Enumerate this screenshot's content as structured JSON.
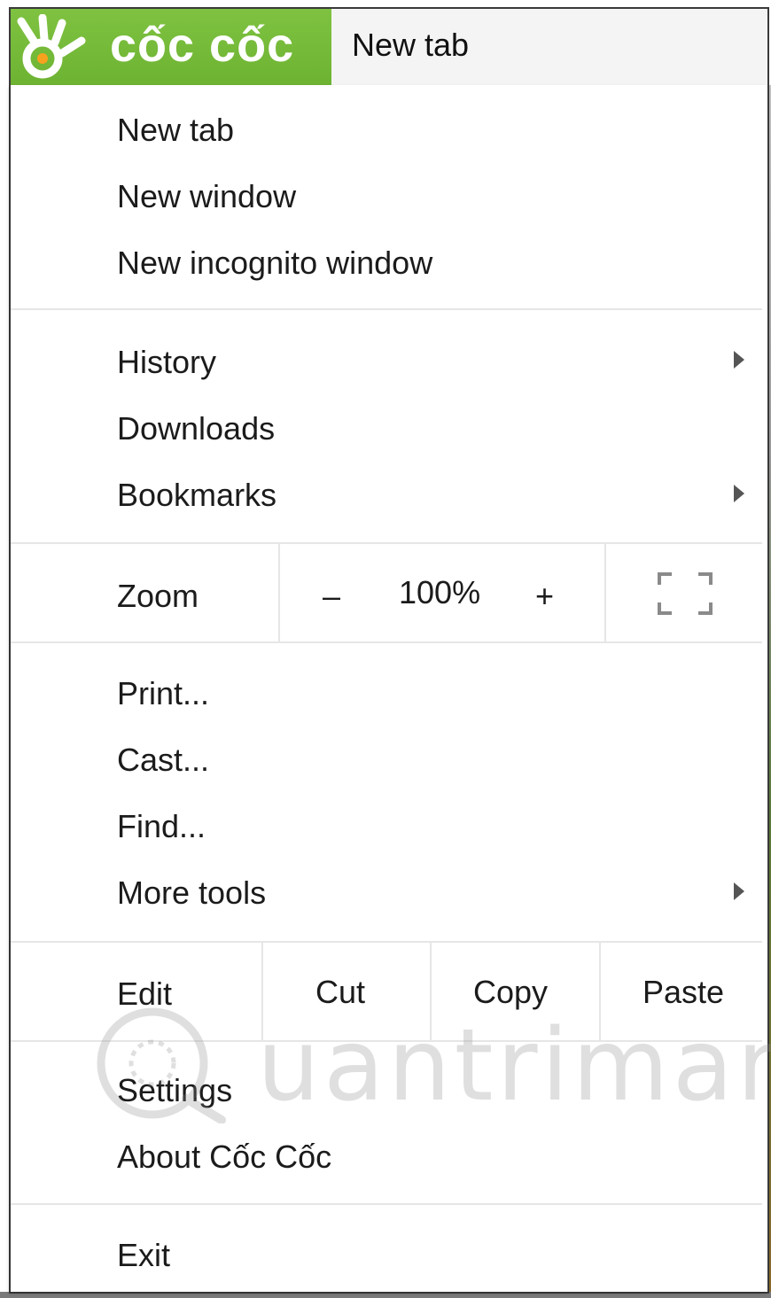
{
  "browser": {
    "logo_text": "cốc cốc",
    "tab_title": "New tab",
    "brand_color": "#6db332"
  },
  "menu": {
    "group1": [
      "New tab",
      "New window",
      "New incognito window"
    ],
    "history": "History",
    "downloads": "Downloads",
    "bookmarks": "Bookmarks",
    "zoom": {
      "label": "Zoom",
      "minus": "–",
      "value": "100%",
      "plus": "+",
      "fullscreen_icon": "fullscreen-icon"
    },
    "print": "Print...",
    "cast": "Cast...",
    "find": "Find...",
    "more_tools": "More tools",
    "edit": {
      "label": "Edit",
      "cut": "Cut",
      "copy": "Copy",
      "paste": "Paste"
    },
    "settings": "Settings",
    "about": "About Cốc Cốc",
    "exit": "Exit"
  },
  "watermark": {
    "text": "uantrimang"
  }
}
